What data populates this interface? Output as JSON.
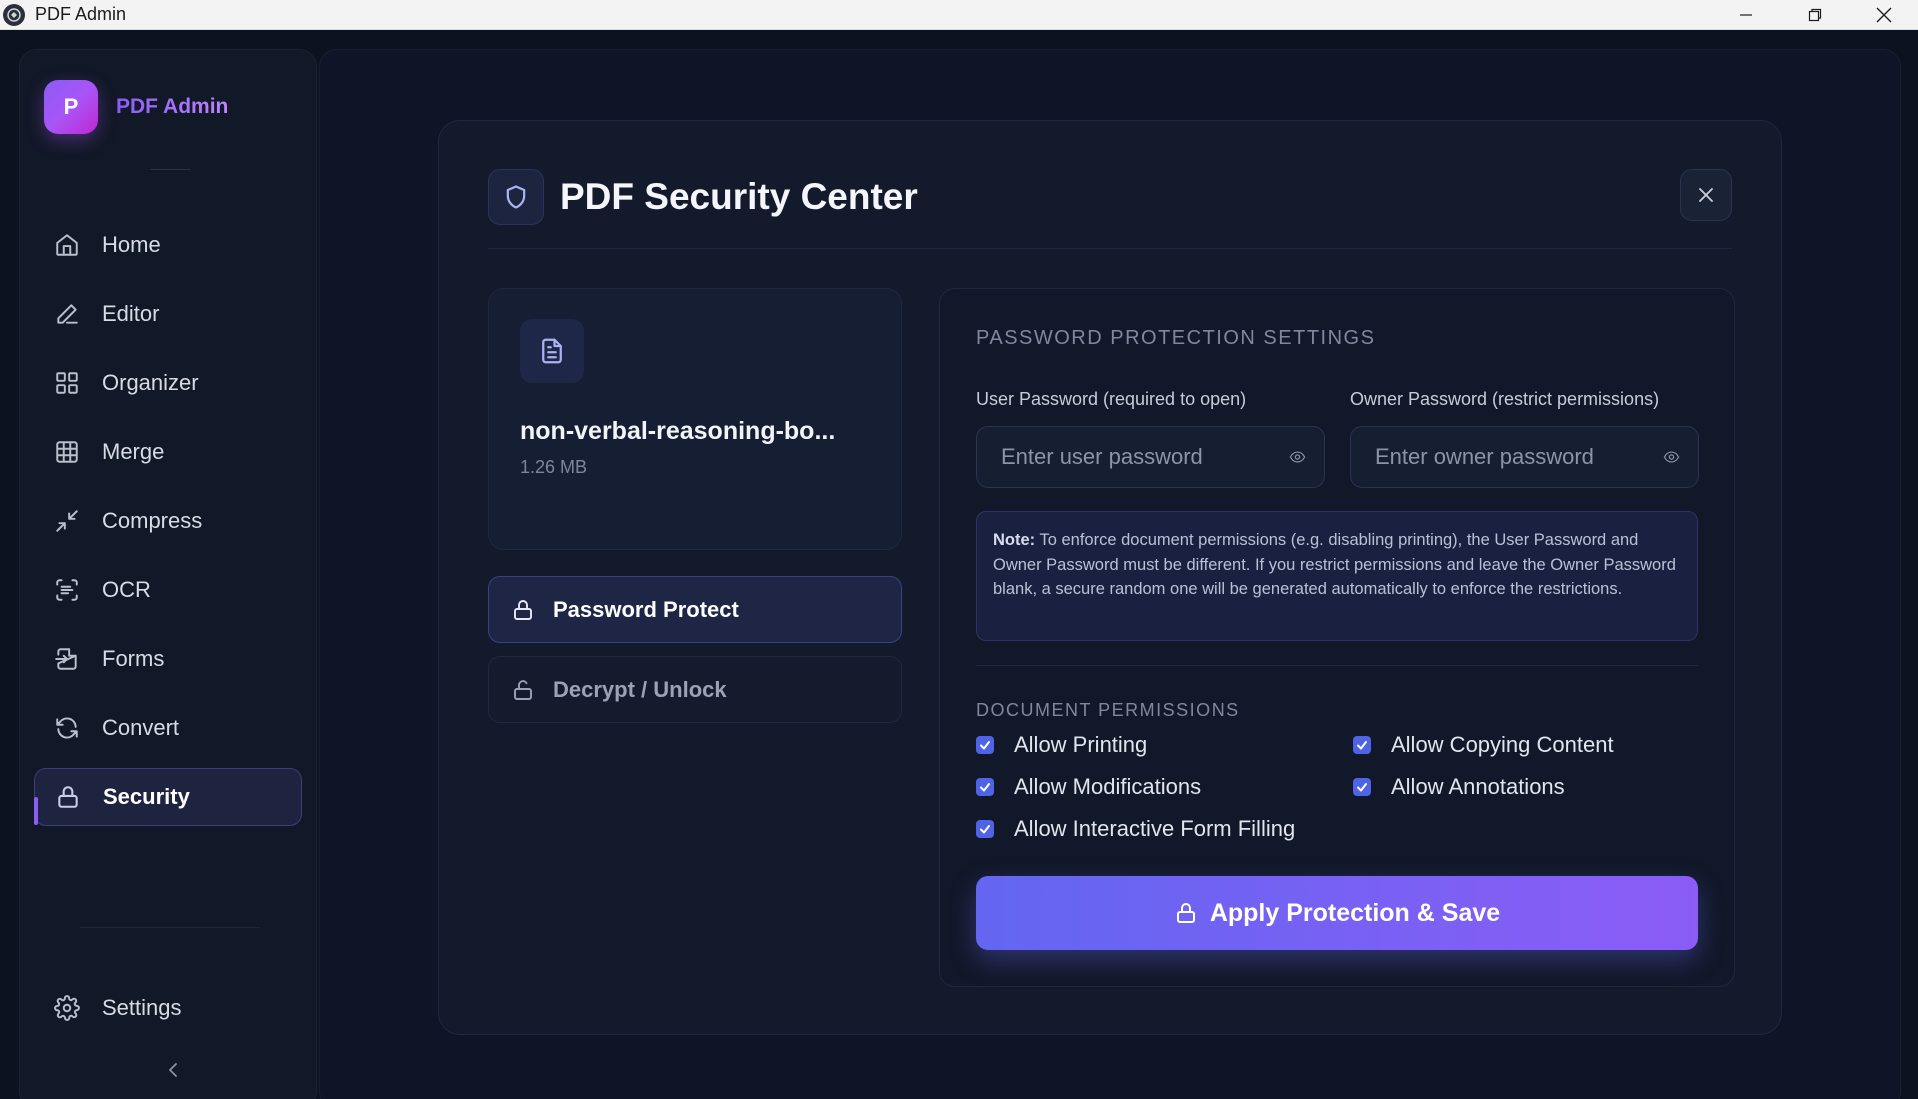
{
  "window": {
    "title": "PDF Admin"
  },
  "sidebar": {
    "brand_initial": "P",
    "brand_name": "PDF Admin",
    "items": [
      {
        "label": "Home",
        "icon": "home-icon"
      },
      {
        "label": "Editor",
        "icon": "pencil-icon"
      },
      {
        "label": "Organizer",
        "icon": "grid-icon"
      },
      {
        "label": "Merge",
        "icon": "table-icon"
      },
      {
        "label": "Compress",
        "icon": "compress-icon"
      },
      {
        "label": "OCR",
        "icon": "scan-text-icon"
      },
      {
        "label": "Forms",
        "icon": "form-import-icon"
      },
      {
        "label": "Convert",
        "icon": "refresh-icon"
      },
      {
        "label": "Security",
        "icon": "lock-icon",
        "active": true
      }
    ],
    "settings_label": "Settings"
  },
  "modal": {
    "title": "PDF Security Center",
    "file": {
      "name": "non-verbal-reasoning-bo...",
      "size": "1.26 MB"
    },
    "modes": {
      "protect_label": "Password Protect",
      "unlock_label": "Decrypt / Unlock"
    },
    "password_section": {
      "title": "PASSWORD PROTECTION SETTINGS",
      "user_label": "User Password (required to open)",
      "user_placeholder": "Enter user password",
      "owner_label": "Owner Password (restrict permissions)",
      "owner_placeholder": "Enter owner password",
      "note_prefix": "Note:",
      "note_text": "To enforce document permissions (e.g. disabling printing), the User Password and Owner Password must be different. If you restrict permissions and leave the Owner Password blank, a secure random one will be generated automatically to enforce the restrictions."
    },
    "permissions": {
      "title": "DOCUMENT PERMISSIONS",
      "printing": "Allow Printing",
      "copying": "Allow Copying Content",
      "modifications": "Allow Modifications",
      "annotations": "Allow Annotations",
      "form_filling": "Allow Interactive Form Filling"
    },
    "apply_label": "Apply Protection & Save"
  },
  "colors": {
    "accent": "#6366f1",
    "accent_end": "#8b5cf6",
    "background": "#0c1220",
    "panel": "#121a2b"
  }
}
